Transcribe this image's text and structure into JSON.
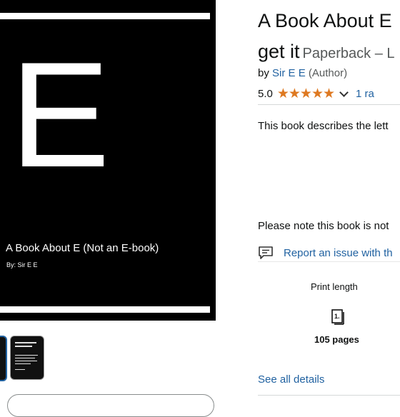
{
  "cover": {
    "big_letter": "E",
    "title": "A Book About E (Not an E-book)",
    "author": "By: Sir E E"
  },
  "product": {
    "title_line1": "A Book About E",
    "title_line2": "get it",
    "binding": "Paperback – L",
    "by": "by",
    "author_name": "Sir E E",
    "author_role": "(Author)",
    "rating_value": "5.0",
    "rating_stars": 5,
    "ratings_link": "1 ra",
    "description": "This book describes the lett",
    "note": "Please note this book is not",
    "report_link": "Report an issue with th"
  },
  "specs": {
    "label": "Print length",
    "icon": "book-pages-icon",
    "value": "105 pages"
  },
  "see_all": "See all details",
  "colors": {
    "link": "#2162a1",
    "star": "#de7921"
  }
}
